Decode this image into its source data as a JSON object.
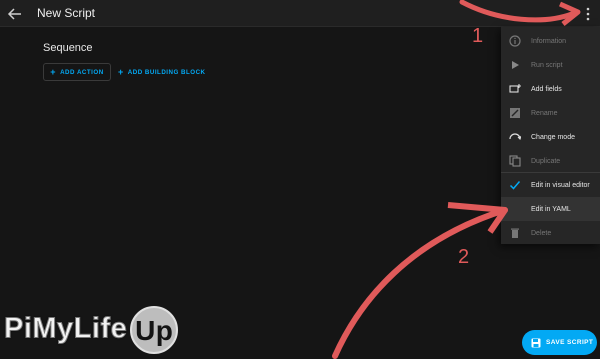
{
  "header": {
    "title": "New Script"
  },
  "editor": {
    "section_heading": "Sequence",
    "add_action_label": "ADD ACTION",
    "add_building_block_label": "ADD BUILDING BLOCK"
  },
  "menu": {
    "items": [
      {
        "label": "Information",
        "icon": "info-icon",
        "disabled": true
      },
      {
        "label": "Run script",
        "icon": "play-icon",
        "disabled": true
      },
      {
        "label": "Add fields",
        "icon": "add-fields-icon",
        "disabled": false
      },
      {
        "label": "Rename",
        "icon": "rename-icon",
        "disabled": true
      },
      {
        "label": "Change mode",
        "icon": "change-mode-icon",
        "disabled": false
      },
      {
        "label": "Duplicate",
        "icon": "duplicate-icon",
        "disabled": true
      },
      {
        "label": "Edit in visual editor",
        "icon": "check-icon",
        "disabled": false
      },
      {
        "label": "Edit in YAML",
        "icon": "",
        "disabled": false
      },
      {
        "label": "Delete",
        "icon": "trash-icon",
        "disabled": true
      }
    ]
  },
  "save_button": {
    "label": "SAVE SCRIPT"
  },
  "annotations": {
    "step_1": "1",
    "step_2": "2"
  },
  "watermark": {
    "text_part1": "PiMyLife",
    "text_part2": "Up"
  },
  "colors": {
    "accent": "#03a9f4",
    "annotation": "#e05a5a",
    "background": "#141414",
    "menu_background": "#262626"
  }
}
